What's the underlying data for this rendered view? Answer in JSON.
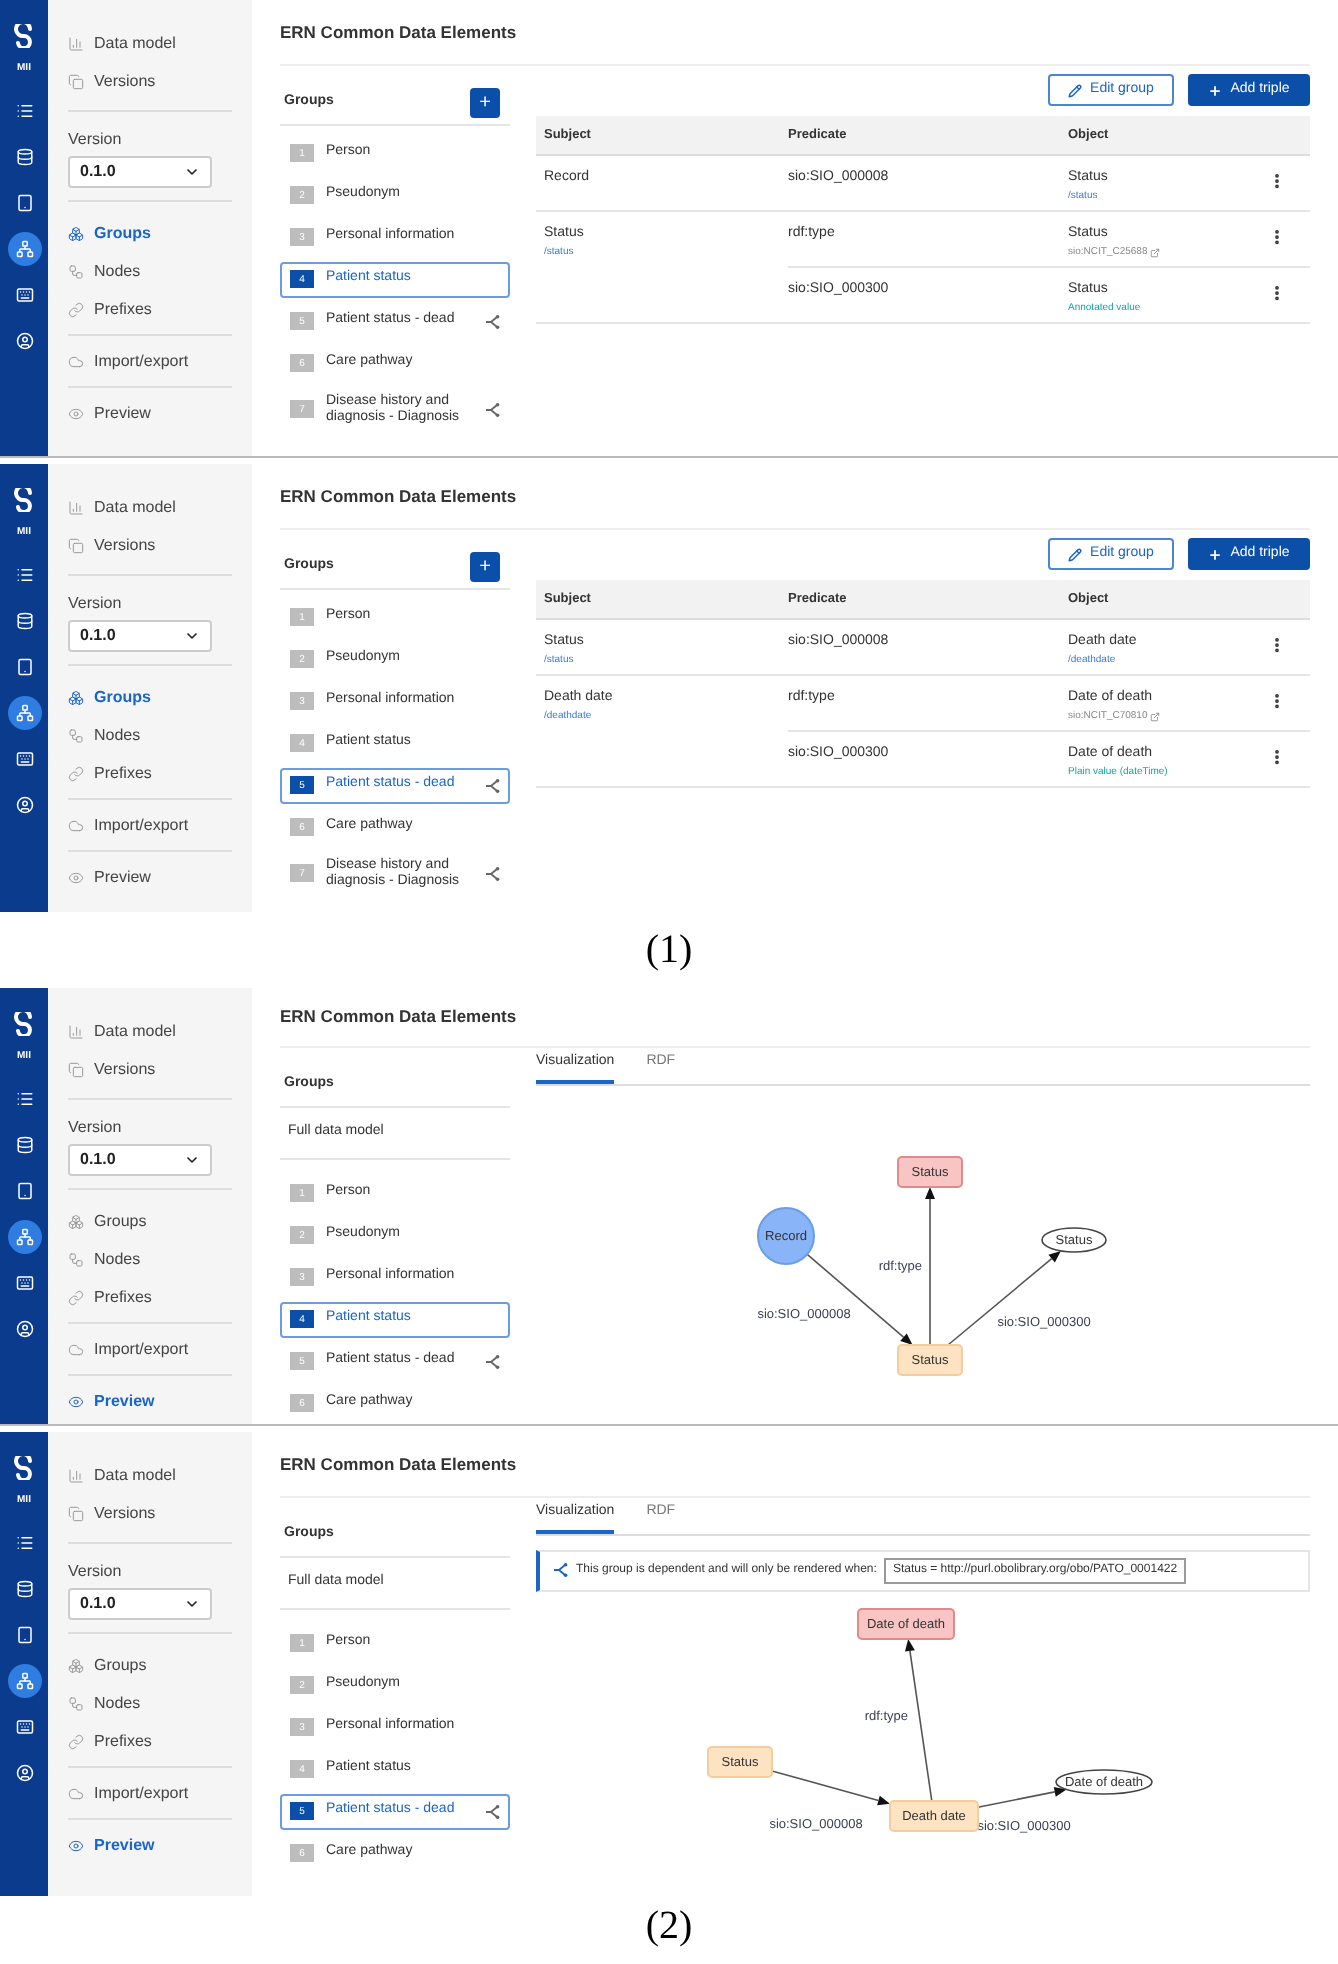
{
  "sections": [
    {
      "caption": "(1)",
      "panels": [
        {
          "kind": "table",
          "rail": {
            "label": "MII",
            "items": [
              {
                "kind": "list",
                "selected": false
              },
              {
                "kind": "database",
                "selected": false
              },
              {
                "kind": "tablet",
                "selected": false
              },
              {
                "kind": "network",
                "selected": true
              },
              {
                "kind": "keyboard",
                "selected": false
              },
              {
                "kind": "user",
                "selected": false
              }
            ]
          },
          "nav": {
            "top": [
              {
                "kind": "chart",
                "label": "Data model",
                "selected": false
              },
              {
                "kind": "copy",
                "label": "Versions",
                "selected": false
              }
            ],
            "version": {
              "label": "Version",
              "value": "0.1.0"
            },
            "middle": [
              {
                "kind": "groups",
                "label": "Groups",
                "selected": true
              },
              {
                "kind": "nodes",
                "label": "Nodes",
                "selected": false
              },
              {
                "kind": "link",
                "label": "Prefixes",
                "selected": false
              }
            ],
            "bottom": [
              {
                "kind": "cloud",
                "label": "Import/export",
                "selected": false
              },
              {
                "kind": "eye",
                "label": "Preview",
                "selected": false
              }
            ]
          },
          "title": "ERN Common Data Elements",
          "groups": {
            "header": "Groups",
            "add_button": "+",
            "items": [
              {
                "number": "1",
                "label": "Person",
                "selected": false,
                "dependent": false
              },
              {
                "number": "2",
                "label": "Pseudonym",
                "selected": false,
                "dependent": false
              },
              {
                "number": "3",
                "label": "Personal information",
                "selected": false,
                "dependent": false
              },
              {
                "number": "4",
                "label": "Patient status",
                "selected": true,
                "dependent": false
              },
              {
                "number": "5",
                "label": "Patient status - dead",
                "selected": false,
                "dependent": true
              },
              {
                "number": "6",
                "label": "Care pathway",
                "selected": false,
                "dependent": false
              },
              {
                "number": "7",
                "label": "Disease history and diagnosis - Diagnosis",
                "selected": false,
                "dependent": true
              }
            ]
          },
          "actions": [
            {
              "kind": "outline",
              "label": "Edit group"
            },
            {
              "kind": "primary",
              "label": "Add triple"
            }
          ],
          "table": {
            "columns": [
              "Subject",
              "Predicate",
              "Object"
            ],
            "subjects": [
              {
                "label": "Record",
                "triples": [
                  {
                    "predicate": "sio:SIO_000008",
                    "object": "Status",
                    "note": "/status",
                    "kind": "path"
                  }
                ]
              },
              {
                "label": "Status",
                "path": "/status",
                "triples": [
                  {
                    "predicate": "rdf:type",
                    "object": "Status",
                    "note": "sio:NCIT_C25688",
                    "kind": "iri"
                  },
                  {
                    "predicate": "sio:SIO_000300",
                    "object": "Status",
                    "note": "Annotated value",
                    "kind": "value"
                  }
                ]
              }
            ]
          }
        },
        {
          "kind": "table",
          "rail": {
            "label": "MII",
            "items": [
              {
                "kind": "list",
                "selected": false
              },
              {
                "kind": "database",
                "selected": false
              },
              {
                "kind": "tablet",
                "selected": false
              },
              {
                "kind": "network",
                "selected": true
              },
              {
                "kind": "keyboard",
                "selected": false
              },
              {
                "kind": "user",
                "selected": false
              }
            ]
          },
          "nav": {
            "top": [
              {
                "kind": "chart",
                "label": "Data model",
                "selected": false
              },
              {
                "kind": "copy",
                "label": "Versions",
                "selected": false
              }
            ],
            "version": {
              "label": "Version",
              "value": "0.1.0"
            },
            "middle": [
              {
                "kind": "groups",
                "label": "Groups",
                "selected": true
              },
              {
                "kind": "nodes",
                "label": "Nodes",
                "selected": false
              },
              {
                "kind": "link",
                "label": "Prefixes",
                "selected": false
              }
            ],
            "bottom": [
              {
                "kind": "cloud",
                "label": "Import/export",
                "selected": false
              },
              {
                "kind": "eye",
                "label": "Preview",
                "selected": false
              }
            ]
          },
          "title": "ERN Common Data Elements",
          "groups": {
            "header": "Groups",
            "add_button": "+",
            "items": [
              {
                "number": "1",
                "label": "Person",
                "selected": false,
                "dependent": false
              },
              {
                "number": "2",
                "label": "Pseudonym",
                "selected": false,
                "dependent": false
              },
              {
                "number": "3",
                "label": "Personal information",
                "selected": false,
                "dependent": false
              },
              {
                "number": "4",
                "label": "Patient status",
                "selected": false,
                "dependent": false
              },
              {
                "number": "5",
                "label": "Patient status - dead",
                "selected": true,
                "dependent": true
              },
              {
                "number": "6",
                "label": "Care pathway",
                "selected": false,
                "dependent": false
              },
              {
                "number": "7",
                "label": "Disease history and diagnosis - Diagnosis",
                "selected": false,
                "dependent": true
              }
            ]
          },
          "actions": [
            {
              "kind": "outline",
              "label": "Edit group"
            },
            {
              "kind": "primary",
              "label": "Add triple"
            }
          ],
          "table": {
            "columns": [
              "Subject",
              "Predicate",
              "Object"
            ],
            "subjects": [
              {
                "label": "Status",
                "path": "/status",
                "triples": [
                  {
                    "predicate": "sio:SIO_000008",
                    "object": "Death date",
                    "note": "/deathdate",
                    "kind": "path"
                  }
                ]
              },
              {
                "label": "Death date",
                "path": "/deathdate",
                "triples": [
                  {
                    "predicate": "rdf:type",
                    "object": "Date of death",
                    "note": "sio:NCIT_C70810",
                    "kind": "iri"
                  },
                  {
                    "predicate": "sio:SIO_000300",
                    "object": "Date of death",
                    "note": "Plain value (dateTime)",
                    "kind": "value"
                  }
                ]
              }
            ]
          }
        }
      ]
    },
    {
      "caption": "(2)",
      "panels": [
        {
          "kind": "graph",
          "rail": {
            "label": "MII",
            "items": [
              {
                "kind": "list",
                "selected": false
              },
              {
                "kind": "database",
                "selected": false
              },
              {
                "kind": "tablet",
                "selected": false
              },
              {
                "kind": "network",
                "selected": true
              },
              {
                "kind": "keyboard",
                "selected": false
              },
              {
                "kind": "user",
                "selected": false
              }
            ]
          },
          "nav": {
            "top": [
              {
                "kind": "chart",
                "label": "Data model",
                "selected": false
              },
              {
                "kind": "copy",
                "label": "Versions",
                "selected": false
              }
            ],
            "version": {
              "label": "Version",
              "value": "0.1.0"
            },
            "middle": [
              {
                "kind": "groups",
                "label": "Groups",
                "selected": false
              },
              {
                "kind": "nodes",
                "label": "Nodes",
                "selected": false
              },
              {
                "kind": "link",
                "label": "Prefixes",
                "selected": false
              }
            ],
            "bottom": [
              {
                "kind": "cloud",
                "label": "Import/export",
                "selected": false
              },
              {
                "kind": "eye",
                "label": "Preview",
                "selected": true
              }
            ]
          },
          "title": "ERN Common Data Elements",
          "groups": {
            "header": "Groups",
            "full_model": "Full data model",
            "items": [
              {
                "number": "1",
                "label": "Person",
                "selected": false,
                "dependent": false
              },
              {
                "number": "2",
                "label": "Pseudonym",
                "selected": false,
                "dependent": false
              },
              {
                "number": "3",
                "label": "Personal information",
                "selected": false,
                "dependent": false
              },
              {
                "number": "4",
                "label": "Patient status",
                "selected": true,
                "dependent": false
              },
              {
                "number": "5",
                "label": "Patient status - dead",
                "selected": false,
                "dependent": true
              },
              {
                "number": "6",
                "label": "Care pathway",
                "selected": false,
                "dependent": false
              }
            ]
          },
          "tabs": [
            {
              "label": "Visualization",
              "selected": true
            },
            {
              "label": "RDF",
              "selected": false
            }
          ],
          "graph": {
            "nodes": [
              {
                "kind": "circle",
                "label": "Record"
              },
              {
                "kind": "class",
                "label": "Status"
              },
              {
                "kind": "literal",
                "label": "Status"
              },
              {
                "kind": "resource",
                "label": "Status"
              }
            ],
            "edges": [
              {
                "label": "sio:SIO_000008"
              },
              {
                "label": "rdf:type"
              },
              {
                "label": "sio:SIO_000300"
              }
            ]
          }
        },
        {
          "kind": "graph",
          "rail": {
            "label": "MII",
            "items": [
              {
                "kind": "list",
                "selected": false
              },
              {
                "kind": "database",
                "selected": false
              },
              {
                "kind": "tablet",
                "selected": false
              },
              {
                "kind": "network",
                "selected": true
              },
              {
                "kind": "keyboard",
                "selected": false
              },
              {
                "kind": "user",
                "selected": false
              }
            ]
          },
          "nav": {
            "top": [
              {
                "kind": "chart",
                "label": "Data model",
                "selected": false
              },
              {
                "kind": "copy",
                "label": "Versions",
                "selected": false
              }
            ],
            "version": {
              "label": "Version",
              "value": "0.1.0"
            },
            "middle": [
              {
                "kind": "groups",
                "label": "Groups",
                "selected": false
              },
              {
                "kind": "nodes",
                "label": "Nodes",
                "selected": false
              },
              {
                "kind": "link",
                "label": "Prefixes",
                "selected": false
              }
            ],
            "bottom": [
              {
                "kind": "cloud",
                "label": "Import/export",
                "selected": false
              },
              {
                "kind": "eye",
                "label": "Preview",
                "selected": true
              }
            ]
          },
          "title": "ERN Common Data Elements",
          "groups": {
            "header": "Groups",
            "full_model": "Full data model",
            "items": [
              {
                "number": "1",
                "label": "Person",
                "selected": false,
                "dependent": false
              },
              {
                "number": "2",
                "label": "Pseudonym",
                "selected": false,
                "dependent": false
              },
              {
                "number": "3",
                "label": "Personal information",
                "selected": false,
                "dependent": false
              },
              {
                "number": "4",
                "label": "Patient status",
                "selected": false,
                "dependent": false
              },
              {
                "number": "5",
                "label": "Patient status - dead",
                "selected": true,
                "dependent": true
              },
              {
                "number": "6",
                "label": "Care pathway",
                "selected": false,
                "dependent": false
              }
            ]
          },
          "tabs": [
            {
              "label": "Visualization",
              "selected": true
            },
            {
              "label": "RDF",
              "selected": false
            }
          ],
          "notice": {
            "text": "This group is dependent and will only be rendered when:",
            "condition": "Status = http://purl.obolibrary.org/obo/PATO_0001422"
          },
          "graph": {
            "nodes": [
              {
                "kind": "class",
                "label": "Date of death"
              },
              {
                "kind": "resource",
                "label": "Status"
              },
              {
                "kind": "resource",
                "label": "Death date"
              },
              {
                "kind": "literal",
                "label": "Date of death"
              }
            ],
            "edges": [
              {
                "label": "sio:SIO_000008"
              },
              {
                "label": "rdf:type"
              },
              {
                "label": "sio:SIO_000300"
              }
            ]
          }
        }
      ]
    }
  ]
}
